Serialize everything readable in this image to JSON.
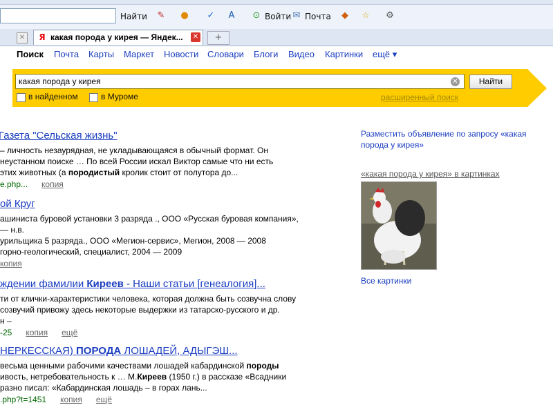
{
  "browser": {
    "find_label": "Найти",
    "login_label": "Войти",
    "mail_label": "Почта",
    "tab_title": "какая порода у кирея — Яндек...",
    "new_tab_symbol": "+"
  },
  "nav": {
    "items": [
      "Поиск",
      "Почта",
      "Карты",
      "Маркет",
      "Новости",
      "Словари",
      "Блоги",
      "Видео",
      "Картинки",
      "ещё ▾"
    ]
  },
  "search": {
    "query": "какая порода у кирея",
    "button_label": "Найти",
    "options": [
      "в найденном",
      "в Муроме"
    ],
    "advanced_link": "расширенный поиск"
  },
  "results": [
    {
      "title": "Газета \"Сельская жизнь\"",
      "snippet": [
        "– личность незаурядная, не укладывающаяся в обычный формат. Он",
        "неустанном поиске … По всей России искал Виктор самые что ни есть",
        "этих животных (а <b>породистый</b> кролик стоит от полутора до..."
      ],
      "url": "e.php...",
      "links": [
        "копия"
      ]
    },
    {
      "title": "ой Круг",
      "snippet": [
        "ашиниста буровой установки 3 разряда ., ООО «Русская буровая компания»,",
        "— н.в.",
        "урильщика 5 разряда., ООО «Мегион-сервис», Мегион, 2008 — 2008",
        "горно-геологический, специалист, 2004 — 2009"
      ],
      "url": "",
      "links": [
        "копия"
      ]
    },
    {
      "title": "ждении фамилии <b>Киреев</b> - Наши статьи [генеалогия]...",
      "snippet": [
        "ти от клички-характеристики человека, которая должна быть созвучна слову",
        "созвучий привожу здесь некоторые выдержки из татарско-русского и др.",
        "н –"
      ],
      "url": "-25",
      "links": [
        "копия",
        "ещё"
      ]
    },
    {
      "title": "НЕРКЕССКАЯ) <b>ПОРОДА</b> ЛОШАДЕЙ, АДЫГЭШ...",
      "snippet": [
        "весьма ценными рабочими качествами лошадей кабардинской <b>породы</b>",
        "ивость, нетребовательность к … М.<b>Киреев</b> (1950 г.) в рассказе «Всадники",
        "разно писал: «Кабардинская лошадь – в горах лань..."
      ],
      "url": ".php?t=1451",
      "links": [
        "копия",
        "ещё"
      ]
    }
  ],
  "sidebar": {
    "ad_link": "Разместить объявление по запросу «какая порода у кирея»",
    "images_header": "«какая порода у кирея» в картинках",
    "all_images": "Все картинки"
  }
}
